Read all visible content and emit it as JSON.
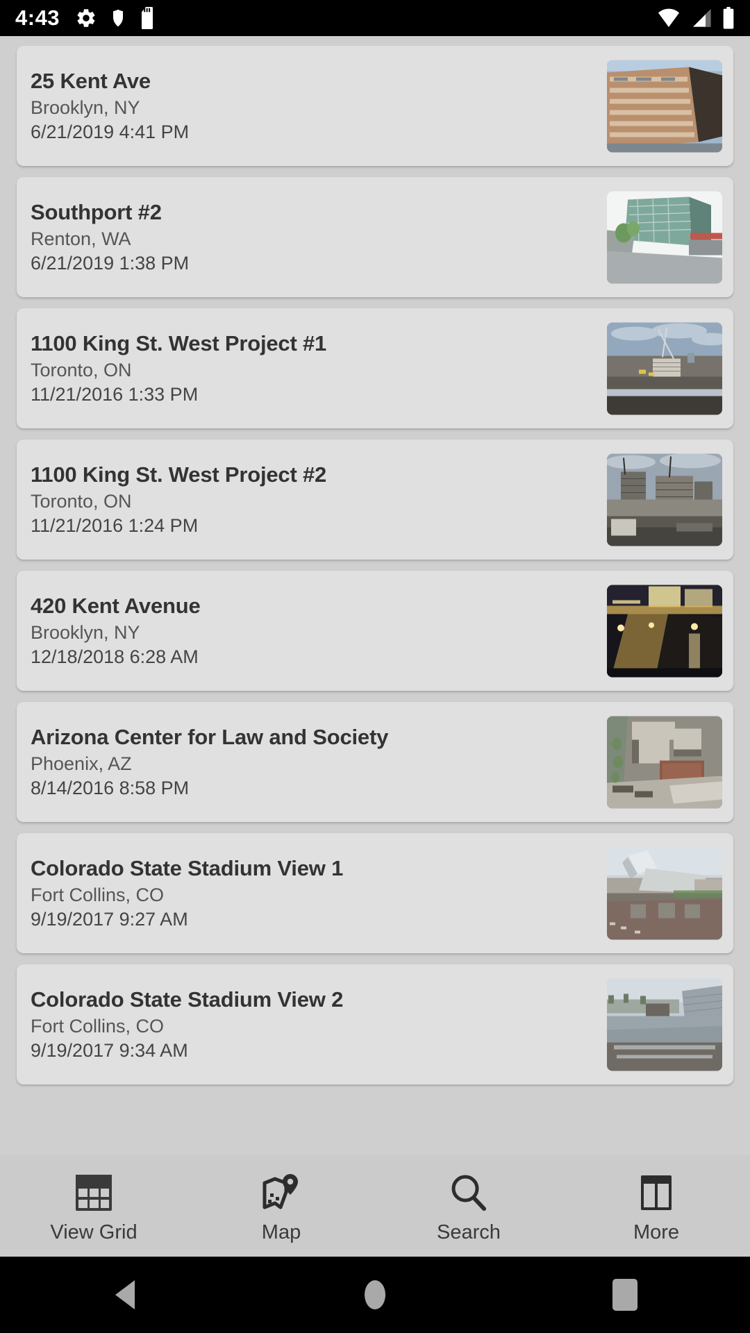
{
  "statusbar": {
    "time": "4:43",
    "left_icons": [
      "gear-icon",
      "shield-icon",
      "sd-card-icon"
    ],
    "right_icons": [
      "wifi-icon",
      "cellular-signal-icon",
      "battery-icon"
    ]
  },
  "list": {
    "items": [
      {
        "title": "25 Kent Ave",
        "location": "Brooklyn, NY",
        "datetime": "6/21/2019 4:41 PM",
        "thumbnail": "construction-brick-building-daytime",
        "thumb_colors": [
          "#9fb7cc",
          "#b08a6a",
          "#c9a98a",
          "#4a4540"
        ]
      },
      {
        "title": "Southport #2",
        "location": "Renton, WA",
        "datetime": "6/21/2019 1:38 PM",
        "thumbnail": "glass-tower-construction-aerial",
        "thumb_colors": [
          "#f2f4f3",
          "#7fa89c",
          "#8f9a96",
          "#b5babb"
        ]
      },
      {
        "title": "1100 King St. West Project #1",
        "location": "Toronto, ON",
        "datetime": "11/21/2016 1:33 PM",
        "thumbnail": "crane-skyline-construction-site",
        "thumb_colors": [
          "#93a8bd",
          "#7e7a73",
          "#5e5a55",
          "#3d3a36"
        ]
      },
      {
        "title": "1100 King St. West Project #2",
        "location": "Toronto, ON",
        "datetime": "11/21/2016 1:24 PM",
        "thumbnail": "concrete-frame-construction-cranes",
        "thumb_colors": [
          "#9aa6b2",
          "#8b8880",
          "#6d6a64",
          "#46443f"
        ]
      },
      {
        "title": "420 Kent Avenue",
        "location": "Brooklyn, NY",
        "datetime": "12/18/2018 6:28 AM",
        "thumbnail": "night-city-lights-construction",
        "thumb_colors": [
          "#1b1a22",
          "#3c3320",
          "#d8b45c",
          "#efe0a0"
        ]
      },
      {
        "title": "Arizona Center for Law and Society",
        "location": "Phoenix, AZ",
        "datetime": "8/14/2016 8:58 PM",
        "thumbnail": "aerial-campus-buildings-plaza",
        "thumb_colors": [
          "#9d9a92",
          "#cfcac0",
          "#7a6f62",
          "#5a5750"
        ]
      },
      {
        "title": "Colorado State Stadium View 1",
        "location": "Fort Collins, CO",
        "datetime": "9/19/2017 9:27 AM",
        "thumbnail": "stadium-construction-crane-dusk",
        "thumb_colors": [
          "#cdd4da",
          "#9b9b97",
          "#746a63",
          "#4f4b46"
        ]
      },
      {
        "title": "Colorado State Stadium View 2",
        "location": "Fort Collins, CO",
        "datetime": "9/19/2017 9:34 AM",
        "thumbnail": "stadium-field-grandstand-morning",
        "thumb_colors": [
          "#c5ced6",
          "#8d9aa2",
          "#6f7a6a",
          "#55514c"
        ]
      }
    ]
  },
  "tabbar": {
    "tabs": [
      {
        "label": "View Grid",
        "icon": "grid-icon"
      },
      {
        "label": "Map",
        "icon": "map-pin-icon"
      },
      {
        "label": "Search",
        "icon": "search-icon"
      },
      {
        "label": "More",
        "icon": "panels-icon"
      }
    ]
  },
  "navbar": {
    "buttons": [
      {
        "name": "back",
        "icon": "back-triangle-icon"
      },
      {
        "name": "home",
        "icon": "home-circle-icon"
      },
      {
        "name": "recents",
        "icon": "recents-square-icon"
      }
    ]
  },
  "colors": {
    "page_background": "#cfcfcf",
    "card_background": "#e0e0e0",
    "tabbar_background": "#cbcbcb",
    "title_text": "#333333",
    "secondary_text": "#555555",
    "system_bar": "#000000",
    "nav_icon": "#a9a9a9"
  }
}
